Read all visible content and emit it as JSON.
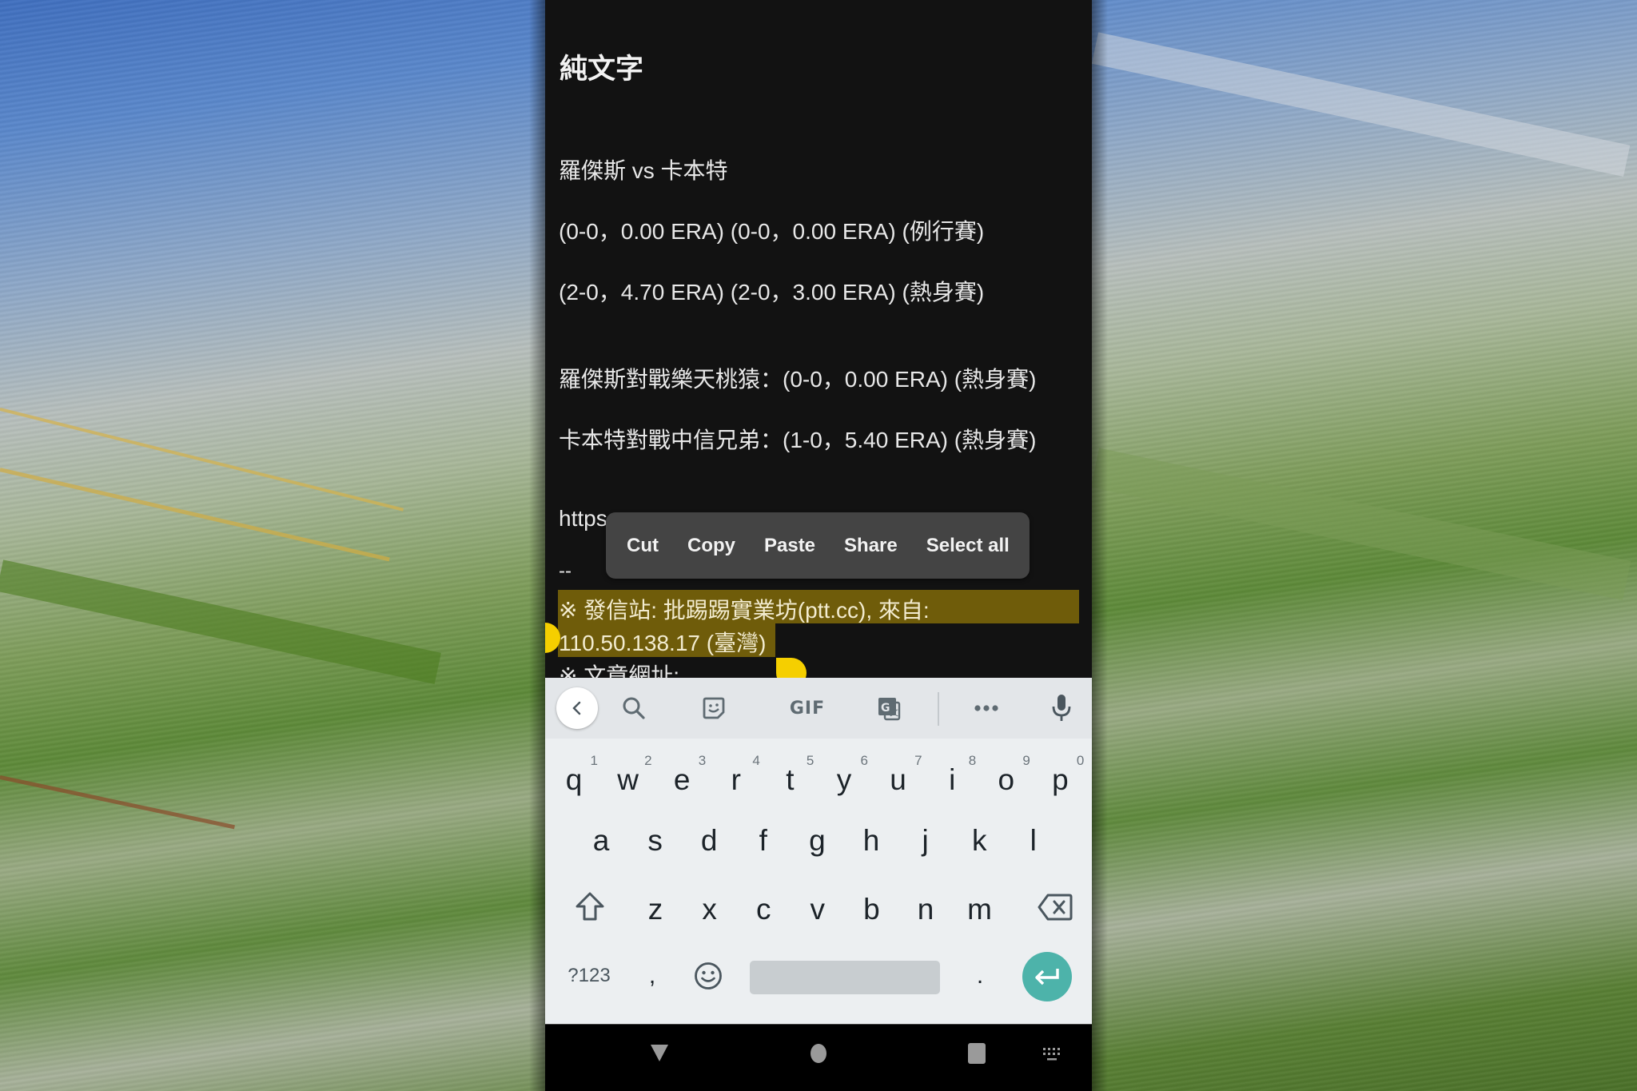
{
  "content": {
    "title": "純文字",
    "lines": [
      "羅傑斯 vs 卡本特",
      "(0-0，0.00 ERA) (0-0，0.00 ERA) (例行賽)",
      "(2-0，4.70 ERA) (2-0，3.00 ERA) (熱身賽)",
      "羅傑斯對戰樂天桃猿：(0-0，0.00 ERA) (熱身賽)",
      "卡本特對戰中信兄弟：(1-0，5.40 ERA) (熱身賽)",
      "https",
      "--"
    ],
    "selected_lines": [
      "※ 發信站: 批踢踢實業坊(ptt.cc), 來自:",
      "110.50.138.17 (臺灣)"
    ],
    "partial_line": "※ 文章網址:",
    "selection_color": "#6f5c0a",
    "handle_color": "#f5cf00"
  },
  "context_menu": {
    "items": [
      "Cut",
      "Copy",
      "Paste",
      "Share",
      "Select all"
    ]
  },
  "keyboard": {
    "toolbar": [
      {
        "icon": "chevron-left-icon"
      },
      {
        "icon": "search-icon"
      },
      {
        "icon": "sticker-icon"
      },
      {
        "icon": "gif-icon",
        "label": "GIF"
      },
      {
        "icon": "translate-icon"
      },
      {
        "icon": "more-icon"
      },
      {
        "icon": "microphone-icon"
      }
    ],
    "row1": [
      {
        "key": "q",
        "hint": "1"
      },
      {
        "key": "w",
        "hint": "2"
      },
      {
        "key": "e",
        "hint": "3"
      },
      {
        "key": "r",
        "hint": "4"
      },
      {
        "key": "t",
        "hint": "5"
      },
      {
        "key": "y",
        "hint": "6"
      },
      {
        "key": "u",
        "hint": "7"
      },
      {
        "key": "i",
        "hint": "8"
      },
      {
        "key": "o",
        "hint": "9"
      },
      {
        "key": "p",
        "hint": "0"
      }
    ],
    "row2": [
      "a",
      "s",
      "d",
      "f",
      "g",
      "h",
      "j",
      "k",
      "l"
    ],
    "row3": [
      "z",
      "x",
      "c",
      "v",
      "b",
      "n",
      "m"
    ],
    "symbols_label": "?123",
    "comma": ",",
    "period": ".",
    "accent_color": "#4db3aa"
  },
  "navbar": {
    "buttons": [
      "back",
      "home",
      "recents",
      "keyboard-switch"
    ]
  }
}
